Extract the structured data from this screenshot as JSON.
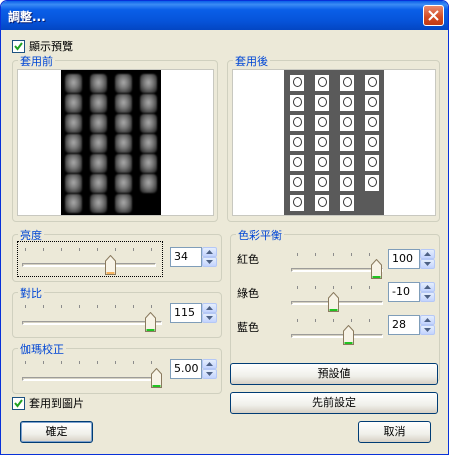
{
  "window": {
    "title": "調整..."
  },
  "preview_checkbox": {
    "label": "顯示預覽",
    "checked": true
  },
  "before_panel": {
    "label": "套用前"
  },
  "after_panel": {
    "label": "套用後"
  },
  "brightness": {
    "label": "亮度",
    "value": "34"
  },
  "contrast": {
    "label": "對比",
    "value": "115"
  },
  "gamma": {
    "label": "伽瑪校正",
    "value": "5.00"
  },
  "color_balance": {
    "label": "色彩平衡",
    "red": {
      "label": "紅色",
      "value": "100"
    },
    "green": {
      "label": "綠色",
      "value": "-10"
    },
    "blue": {
      "label": "藍色",
      "value": "28"
    }
  },
  "apply_checkbox": {
    "label": "套用到圖片",
    "checked": true
  },
  "buttons": {
    "defaults": "預設値",
    "previous": "先前設定",
    "ok": "確定",
    "cancel": "取消"
  },
  "colors": {
    "titlebar": "#0a5fe8",
    "group_label": "#0046d5",
    "close": "#d24a22"
  },
  "icons": [
    "close-icon",
    "check-icon",
    "spin-up-icon",
    "spin-down-icon",
    "slider-thumb-icon"
  ]
}
